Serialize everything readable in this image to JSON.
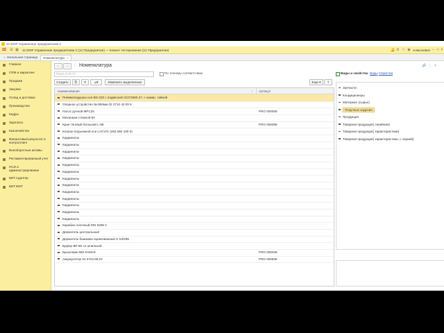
{
  "window": {
    "title": "1С:ERP Управление предприятием 2"
  },
  "app_header": {
    "title": "1С:ERP Управление предприятием 2 (1С:Предприятие) — Клиент тестирования (1С:Предприятие)",
    "user": "Алексеевич"
  },
  "tabs": {
    "home": "Начальная страница",
    "active": "Номенклатура",
    "active_close": "×"
  },
  "sidebar": {
    "items": [
      {
        "label": "Главное",
        "icon": "home-icon"
      },
      {
        "label": "CRM и маркетинг",
        "icon": "crm-icon"
      },
      {
        "label": "Продажи",
        "icon": "sales-icon"
      },
      {
        "label": "Закупки",
        "icon": "purchases-icon"
      },
      {
        "label": "Склад и доставка",
        "icon": "warehouse-icon"
      },
      {
        "label": "Производство",
        "icon": "production-icon"
      },
      {
        "label": "Кадры",
        "icon": "staff-icon"
      },
      {
        "label": "Зарплата",
        "icon": "salary-icon"
      },
      {
        "label": "Казначейство",
        "icon": "treasury-icon"
      },
      {
        "label": "Финансовый результат и контроллинг",
        "icon": "finance-icon"
      },
      {
        "label": "Внеоборотные активы",
        "icon": "assets-icon"
      },
      {
        "label": "Регламентированный учет",
        "icon": "accounting-icon"
      },
      {
        "label": "НСИ и администрирование",
        "icon": "admin-icon"
      },
      {
        "label": "БИТ.Адаптер",
        "icon": "bit-adapter-icon"
      },
      {
        "label": "БИТ.МОТ",
        "icon": "bit-mot-icon"
      }
    ]
  },
  "page": {
    "title": "Номенклатура",
    "back": "←",
    "forward": "→",
    "search_placeholder": "Поиск (Ctrl+F)",
    "exact_match_label": "По точному соответствию"
  },
  "toolbar": {
    "create": "Создать",
    "change_selected": "Изменить выделенные",
    "more": "Еще ▾",
    "help": "?"
  },
  "table": {
    "columns": [
      "Наименование",
      "Артикул"
    ],
    "sort_indicator": "↕",
    "rows": [
      {
        "name": "Пневмоподушка оси BS-220 с подвеской IO372580 27. с камер. тайной",
        "article": "",
        "selected": true
      },
      {
        "name": "Опорное устройство №:850мм 02 3710 43 00 К",
        "article": ""
      },
      {
        "name": "Насос ручной MPC25",
        "article": "PRO 000009"
      },
      {
        "name": "Механизм стяжной 50",
        "article": ""
      },
      {
        "name": "Кран тяговый большой L-88",
        "article": "PRO 000065"
      },
      {
        "name": "Клапан подъемной оси LACV/C (463 084 100 0)",
        "article": ""
      },
      {
        "name": "Кардиналы",
        "article": ""
      },
      {
        "name": "Кардиналы",
        "article": ""
      },
      {
        "name": "Кардиналы",
        "article": ""
      },
      {
        "name": "Кардиналы",
        "article": ""
      },
      {
        "name": "Кардиналы",
        "article": ""
      },
      {
        "name": "Кардиналы",
        "article": ""
      },
      {
        "name": "Кардиналы",
        "article": ""
      },
      {
        "name": "Кардиналы",
        "article": ""
      },
      {
        "name": "Кардиналы",
        "article": ""
      },
      {
        "name": "Кардиналы",
        "article": ""
      },
      {
        "name": "Кардиналы",
        "article": ""
      },
      {
        "name": "Кардиналы",
        "article": ""
      },
      {
        "name": "Кардиналы",
        "article": ""
      },
      {
        "name": "Карабин гоночный DIN 5299 C",
        "article": ""
      },
      {
        "name": "Держатель центральный",
        "article": ""
      },
      {
        "name": "Держатель башмака оцинкованный G 53/295",
        "article": ""
      },
      {
        "name": "Буфер BP-80 со шпилькой",
        "article": ""
      },
      {
        "name": "Брызговик 580 КАМАЗ",
        "article": "PRO 000206"
      },
      {
        "name": "Аккумулятор 02.3722.68.02",
        "article": "PRO 000836"
      }
    ]
  },
  "properties_panel": {
    "title": "Виды и свойства",
    "link_kinds": "Виды",
    "link_props": "Свойства",
    "items": [
      {
        "label": "Запчасти",
        "highlighted": false
      },
      {
        "label": "Кондиционеры",
        "highlighted": false
      },
      {
        "label": "Материал (сырье)",
        "highlighted": false
      },
      {
        "label": "Покупные изделия",
        "highlighted": true
      },
      {
        "label": "Продукция",
        "highlighted": false
      },
      {
        "label": "Товарная продукция( серийная)",
        "highlighted": false
      },
      {
        "label": "Товарная продукция( характеристики)",
        "highlighted": false
      },
      {
        "label": "Товарная продукция( характеристики, с серией)",
        "highlighted": false
      }
    ]
  },
  "colors": {
    "header_yellow": "#fbf0a6",
    "sidebar_yellow": "#fbef9f",
    "selected_row": "#fbe8a8",
    "link_blue": "#2a5db0",
    "brand_red": "#d0021b"
  }
}
